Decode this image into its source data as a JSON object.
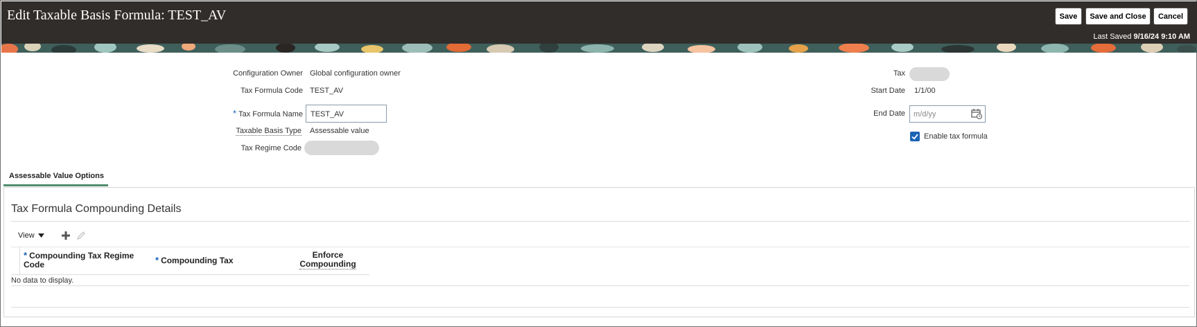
{
  "header": {
    "title": "Edit Taxable Basis Formula: TEST_AV",
    "save_label": "Save",
    "save_close_label": "Save and Close",
    "cancel_label": "Cancel",
    "last_saved_label": "Last Saved",
    "last_saved_value": "9/16/24 9:10 AM"
  },
  "form": {
    "config_owner_label": "Configuration Owner",
    "config_owner_value": "Global configuration owner",
    "formula_code_label": "Tax Formula Code",
    "formula_code_value": "TEST_AV",
    "formula_name_label": "Tax Formula Name",
    "formula_name_value": "TEST_AV",
    "basis_type_label": "Taxable Basis Type",
    "basis_type_value": "Assessable value",
    "regime_code_label": "Tax Regime Code",
    "tax_label": "Tax",
    "start_date_label": "Start Date",
    "start_date_value": "1/1/00",
    "end_date_label": "End Date",
    "end_date_placeholder": "m/d/yy",
    "enable_formula_label": "Enable tax formula",
    "enable_formula_checked": true,
    "required_mark": "*"
  },
  "tabs": {
    "active_label": "Assessable Value Options"
  },
  "section": {
    "title": "Tax Formula Compounding Details",
    "view_label": "View",
    "columns": {
      "regime_code_line1": "Compounding Tax Regime",
      "regime_code_line2": "Code",
      "tax": "Compounding Tax",
      "enforce_line1": "Enforce",
      "enforce_line2": "Compounding"
    },
    "no_data": "No data to display."
  },
  "colors": {
    "header_bg": "#312d2a",
    "accent_blue": "#1a64b4",
    "tab_underline": "#528b6f",
    "placeholder_pill": "#d9d9d9"
  },
  "icons": [
    "calendar-icon",
    "checkmark-icon",
    "add-icon",
    "edit-icon",
    "dropdown-arrow-icon"
  ]
}
